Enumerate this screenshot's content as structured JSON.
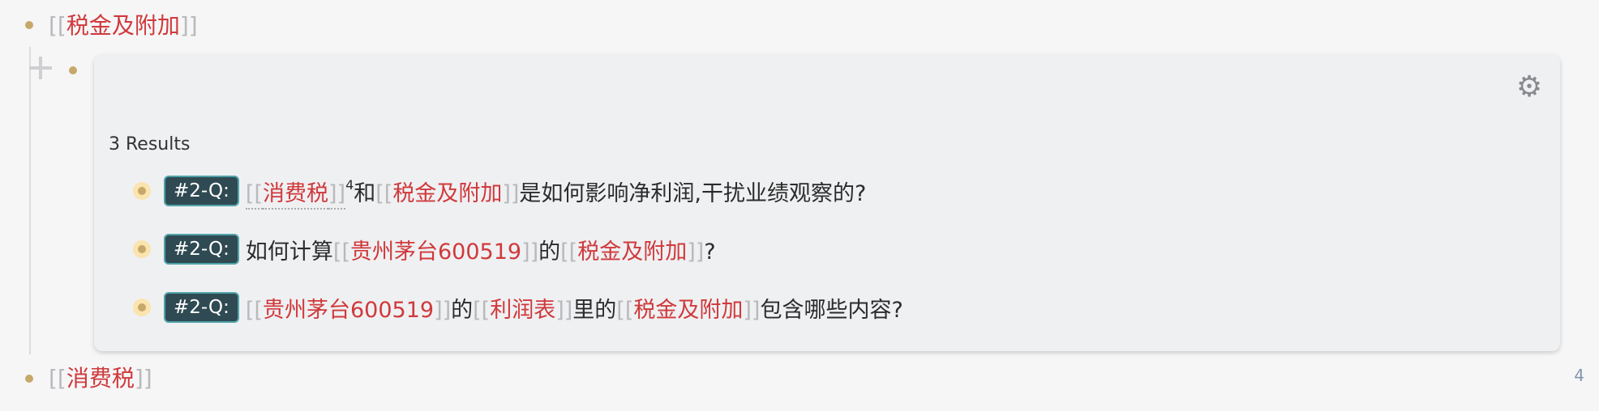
{
  "top_ref": {
    "open": "[[",
    "text": "税金及附加",
    "close": "]]"
  },
  "bottom_ref": {
    "open": "[[",
    "text": "消费税",
    "close": "]]"
  },
  "panel": {
    "results_label": "3 Results",
    "settings_icon": "gear-icon"
  },
  "rows": [
    {
      "tag": "#2-Q:",
      "parts": [
        {
          "t": "[[",
          "c": "br"
        },
        {
          "t": "消费税",
          "c": "lk"
        },
        {
          "t": "]]",
          "c": "br"
        },
        {
          "t": "4",
          "c": "sup"
        },
        {
          "t": "和",
          "c": ""
        },
        {
          "t": "[[",
          "c": "br"
        },
        {
          "t": "税金及附加",
          "c": "lk"
        },
        {
          "t": "]]",
          "c": "br"
        },
        {
          "t": "是如何影响净利润,干扰业绩观察的?",
          "c": ""
        }
      ]
    },
    {
      "tag": "#2-Q:",
      "parts": [
        {
          "t": "如何计算",
          "c": ""
        },
        {
          "t": "[[",
          "c": "br"
        },
        {
          "t": "贵州茅台600519",
          "c": "lk"
        },
        {
          "t": "]]",
          "c": "br"
        },
        {
          "t": "的",
          "c": ""
        },
        {
          "t": "[[",
          "c": "br"
        },
        {
          "t": "税金及附加",
          "c": "lk"
        },
        {
          "t": "]]",
          "c": "br"
        },
        {
          "t": "?",
          "c": ""
        }
      ]
    },
    {
      "tag": "#2-Q:",
      "parts": [
        {
          "t": "[[",
          "c": "br"
        },
        {
          "t": "贵州茅台600519",
          "c": "lk"
        },
        {
          "t": "]]",
          "c": "br"
        },
        {
          "t": "的",
          "c": ""
        },
        {
          "t": "[[",
          "c": "br"
        },
        {
          "t": "利润表",
          "c": "lk"
        },
        {
          "t": "]]",
          "c": "br"
        },
        {
          "t": "里的",
          "c": ""
        },
        {
          "t": "[[",
          "c": "br"
        },
        {
          "t": "税金及附加",
          "c": "lk"
        },
        {
          "t": "]]",
          "c": "br"
        },
        {
          "t": "包含哪些内容?",
          "c": ""
        }
      ]
    }
  ],
  "page_count": "4",
  "colors": {
    "link": "#d0393b",
    "bracket": "#b9b9bd",
    "bullet": "#c6a86a",
    "tag_bg": "#2f4a52"
  }
}
